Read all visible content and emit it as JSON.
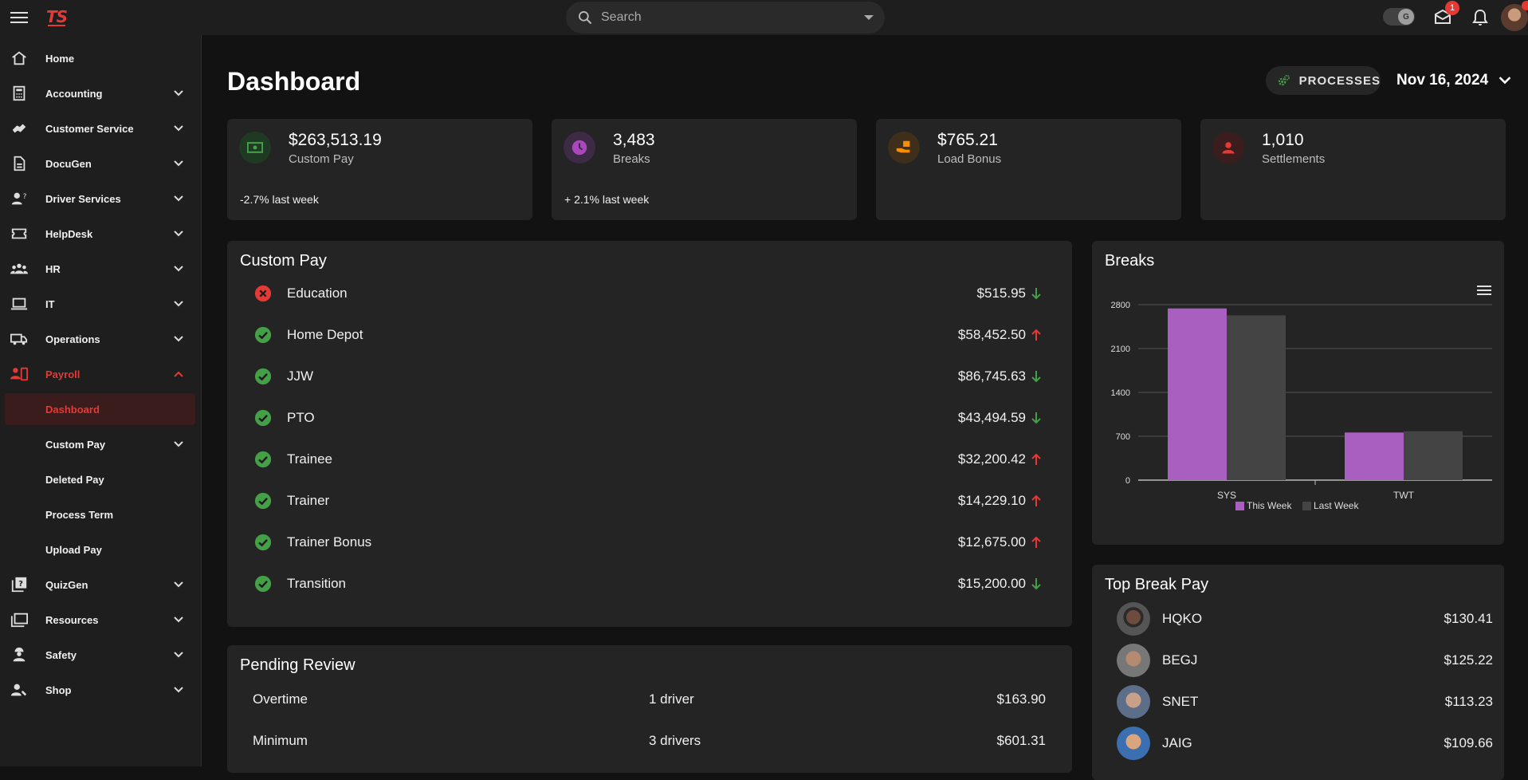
{
  "topbar": {
    "logo": "TS",
    "search_placeholder": "Search",
    "toggle_glyph": "G",
    "messages_badge": "1"
  },
  "sidebar": {
    "items": [
      {
        "label": "Home",
        "icon": "home-icon",
        "expandable": false
      },
      {
        "label": "Accounting",
        "icon": "calculator-icon",
        "expandable": true
      },
      {
        "label": "Customer Service",
        "icon": "handshake-icon",
        "expandable": true
      },
      {
        "label": "DocuGen",
        "icon": "document-icon",
        "expandable": true
      },
      {
        "label": "Driver Services",
        "icon": "person-question-icon",
        "expandable": true
      },
      {
        "label": "HelpDesk",
        "icon": "ticket-icon",
        "expandable": true
      },
      {
        "label": "HR",
        "icon": "group-icon",
        "expandable": true
      },
      {
        "label": "IT",
        "icon": "laptop-icon",
        "expandable": true
      },
      {
        "label": "Operations",
        "icon": "truck-icon",
        "expandable": true
      },
      {
        "label": "Payroll",
        "icon": "payroll-icon",
        "expandable": true,
        "expanded": true
      },
      {
        "label": "Dashboard",
        "sub": true,
        "selected": true
      },
      {
        "label": "Custom Pay",
        "sub": true,
        "expandable": true
      },
      {
        "label": "Deleted Pay",
        "sub": true
      },
      {
        "label": "Process Term",
        "sub": true
      },
      {
        "label": "Upload Pay",
        "sub": true
      },
      {
        "label": "QuizGen",
        "icon": "quiz-icon",
        "expandable": true
      },
      {
        "label": "Resources",
        "icon": "folders-icon",
        "expandable": true
      },
      {
        "label": "Safety",
        "icon": "worker-icon",
        "expandable": true
      },
      {
        "label": "Shop",
        "icon": "person-wrench-icon",
        "expandable": true
      }
    ]
  },
  "header": {
    "title": "Dashboard",
    "processes_label": "PROCESSES",
    "date": "Nov 16, 2024"
  },
  "stats": [
    {
      "value": "$263,513.19",
      "caption": "Custom Pay",
      "footer": "-2.7% last week",
      "color": "#43a047",
      "icon": "cash-icon"
    },
    {
      "value": "3,483",
      "caption": "Breaks",
      "footer": "+ 2.1% last week",
      "color": "#ab47bc",
      "icon": "clock-icon"
    },
    {
      "value": "$765.21",
      "caption": "Load Bonus",
      "footer": "",
      "color": "#fb8c00",
      "icon": "hand-box-icon"
    },
    {
      "value": "1,010",
      "caption": "Settlements",
      "footer": "",
      "color": "#e53935",
      "icon": "person-icon"
    }
  ],
  "custom_pay": {
    "title": "Custom Pay",
    "rows": [
      {
        "name": "Education",
        "amount": "$515.95",
        "status": "error",
        "trend": "down"
      },
      {
        "name": "Home Depot",
        "amount": "$58,452.50",
        "status": "ok",
        "trend": "up"
      },
      {
        "name": "JJW",
        "amount": "$86,745.63",
        "status": "ok",
        "trend": "down"
      },
      {
        "name": "PTO",
        "amount": "$43,494.59",
        "status": "ok",
        "trend": "down"
      },
      {
        "name": "Trainee",
        "amount": "$32,200.42",
        "status": "ok",
        "trend": "up"
      },
      {
        "name": "Trainer",
        "amount": "$14,229.10",
        "status": "ok",
        "trend": "up"
      },
      {
        "name": "Trainer Bonus",
        "amount": "$12,675.00",
        "status": "ok",
        "trend": "up"
      },
      {
        "name": "Transition",
        "amount": "$15,200.00",
        "status": "ok",
        "trend": "down"
      }
    ]
  },
  "pending_review": {
    "title": "Pending Review",
    "rows": [
      {
        "type": "Overtime",
        "drivers": "1 driver",
        "amount": "$163.90"
      },
      {
        "type": "Minimum",
        "drivers": "3 drivers",
        "amount": "$601.31"
      }
    ]
  },
  "breaks_card": {
    "title": "Breaks"
  },
  "chart_data": {
    "type": "bar",
    "title": "Breaks",
    "categories": [
      "SYS",
      "TWT"
    ],
    "series": [
      {
        "name": "This Week",
        "values": [
          2740,
          760
        ],
        "color": "#a95fc0"
      },
      {
        "name": "Last Week",
        "values": [
          2630,
          780
        ],
        "color": "#444444"
      }
    ],
    "yticks": [
      "0",
      "700",
      "1400",
      "2100",
      "2800"
    ],
    "ylim": [
      0,
      2800
    ],
    "grid": true,
    "legend": "bottom"
  },
  "top_break_pay": {
    "title": "Top Break Pay",
    "rows": [
      {
        "name": "HQKO",
        "amount": "$130.41"
      },
      {
        "name": "BEGJ",
        "amount": "$125.22"
      },
      {
        "name": "SNET",
        "amount": "$113.23"
      },
      {
        "name": "JAIG",
        "amount": "$109.66"
      }
    ]
  }
}
